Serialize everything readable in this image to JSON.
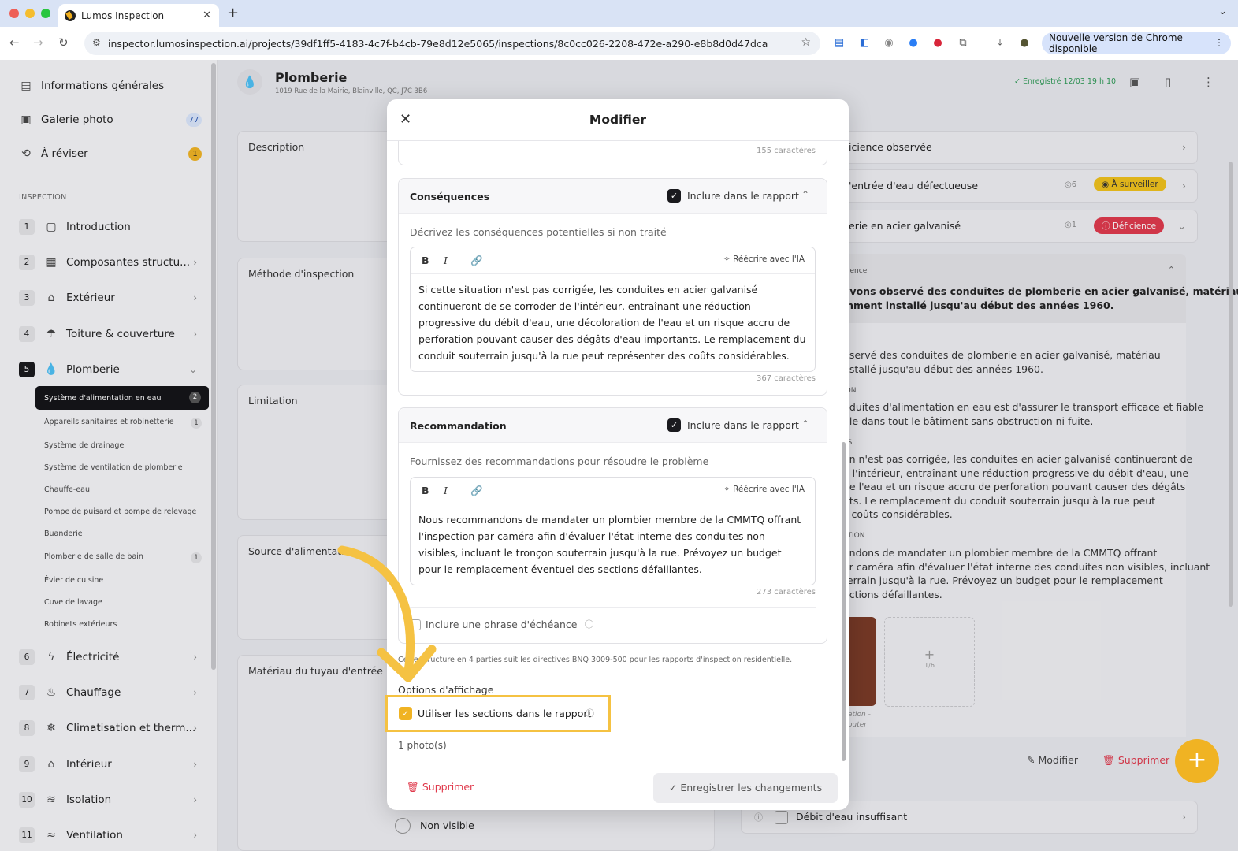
{
  "browser": {
    "tab_title": "Lumos Inspection",
    "url": "inspector.lumosinspection.ai/projects/39df1ff5-4183-4c7f-b4cb-79e8d12e5065/inspections/8c0cc026-2208-472e-a290-e8b8d0d47dca",
    "update_label": "Nouvelle version de Chrome disponible"
  },
  "sidebar": {
    "top": [
      {
        "label": "Informations générales"
      },
      {
        "label": "Galerie photo",
        "badge": "77"
      },
      {
        "label": "À réviser",
        "badge": "1"
      }
    ],
    "section_header": "INSPECTION",
    "sections": [
      {
        "num": "1",
        "label": "Introduction"
      },
      {
        "num": "2",
        "label": "Composantes structu..."
      },
      {
        "num": "3",
        "label": "Extérieur"
      },
      {
        "num": "4",
        "label": "Toiture & couverture"
      },
      {
        "num": "5",
        "label": "Plomberie"
      }
    ],
    "subitems": {
      "active": {
        "label": "Système d'alimentation en eau",
        "badge": "2"
      },
      "items": [
        {
          "label": "Appareils sanitaires et robinetterie",
          "badge": "1"
        },
        {
          "label": "Système de drainage"
        },
        {
          "label": "Système de ventilation de plomberie"
        },
        {
          "label": "Chauffe-eau"
        },
        {
          "label": "Pompe de puisard et pompe de relevage"
        },
        {
          "label": "Buanderie"
        },
        {
          "label": "Plomberie de salle de bain",
          "badge": "1"
        },
        {
          "label": "Évier de cuisine"
        },
        {
          "label": "Cuve de lavage"
        },
        {
          "label": "Robinets extérieurs"
        }
      ]
    },
    "sections2": [
      {
        "num": "6",
        "label": "Électricité"
      },
      {
        "num": "7",
        "label": "Chauffage"
      },
      {
        "num": "8",
        "label": "Climatisation et therm..."
      },
      {
        "num": "9",
        "label": "Intérieur"
      },
      {
        "num": "10",
        "label": "Isolation"
      },
      {
        "num": "11",
        "label": "Ventilation"
      }
    ]
  },
  "header": {
    "title": "Plomberie",
    "address": "1019 Rue de la Mairie, Blainville, QC, J7C 3B6",
    "saved": "Enregistré 12/03 19 h 10"
  },
  "bg_left": {
    "description": "Description",
    "method": "Méthode d'inspection",
    "limitation": "Limitation",
    "source": "Source d'alimentation",
    "material": "Matériau du tuyau d'entrée",
    "non_visible": "Non visible"
  },
  "bg_right": {
    "row1": "icience observée",
    "row2": "'entrée d'eau défectueuse",
    "row2_count": "6",
    "row2_badge": "À surveiller",
    "row3": "erie en acier galvanisé",
    "row3_count": "1",
    "row3_badge": "Déficience",
    "panel_head": "ience",
    "panel_highlight": "avons observé des conduites de plomberie en acier galvanisé, matériau\nmment installé jusqu'au début des années 1960.",
    "h1": "N",
    "t1": "bservé des conduites de plomberie en acier galvanisé, matériau\nnstallé jusqu'au début des années 1960.",
    "h2": "ION",
    "t2": "nduites d'alimentation en eau est d'assurer le transport efficace et fiable\nble dans tout le bâtiment sans obstruction ni fuite.",
    "h3": "ES",
    "t3": "on n'est pas corrigée, les conduites en acier galvanisé continueront de\ne l'intérieur, entraînant une réduction progressive du débit d'eau, une\nde l'eau et un risque accru de perforation pouvant causer des dégâts\nnts. Le remplacement du conduit souterrain jusqu'à la rue peut\ns coûts considérables.",
    "h4": "ATION",
    "t4": "andons de mandater un plombier membre de la CMMTQ offrant\nar caméra afin d'évaluer l'état interne des conduites non visibles, incluant\nterrain jusqu'à la rue. Prévoyez un budget pour le remplacement\nections défaillantes.",
    "photo_caption": "ation -\nouter",
    "add_count": "1/6",
    "edit": "Modifier",
    "delete": "Supprimer",
    "row_bottom": "Débit d'eau insuffisant"
  },
  "modal": {
    "title": "Modifier",
    "top_count": "155 caractères",
    "include_label": "Inclure dans le rapport",
    "ai_label": "Réécrire avec l'IA",
    "consequences": {
      "title": "Conséquences",
      "hint": "Décrivez les conséquences potentielles si non traité",
      "text": "Si cette situation n'est pas corrigée, les conduites en acier galvanisé continueront de se corroder de l'intérieur, entraînant une réduction progressive du débit d'eau, une décoloration de l'eau et un risque accru de perforation pouvant causer des dégâts d'eau importants. Le remplacement du conduit souterrain jusqu'à la rue peut représenter des coûts considérables.",
      "count": "367 caractères"
    },
    "recommendation": {
      "title": "Recommandation",
      "hint": "Fournissez des recommandations pour résoudre le problème",
      "text": "Nous recommandons de mandater un plombier membre de la CMMTQ offrant l'inspection par caméra afin d'évaluer l'état interne des conduites non visibles, incluant le tronçon souterrain jusqu'à la rue. Prévoyez un budget pour le remplacement éventuel des sections défaillantes.",
      "count": "273 caractères",
      "deadline": "Inclure une phrase d'échéance"
    },
    "note": "Cette structure en 4 parties suit les directives BNQ 3009-500 pour les rapports d'inspection résidentielle.",
    "display_options": "Options d'affichage",
    "use_sections": "Utiliser les sections dans le rapport",
    "photos": "1 photo(s)",
    "delete": "Supprimer",
    "save": "Enregistrer les changements"
  },
  "colors": {
    "accent": "#f0b323",
    "danger": "#e0394b",
    "success": "#2e9a55",
    "highlight": "#f5c242"
  }
}
